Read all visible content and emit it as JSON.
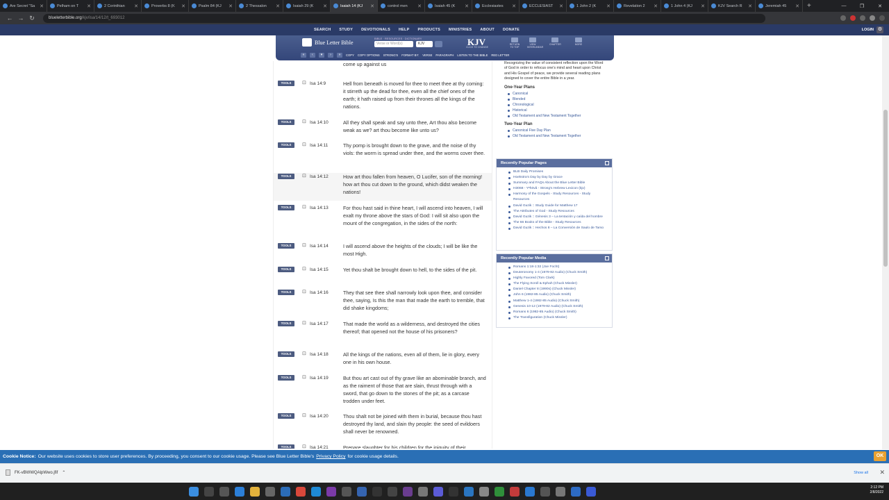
{
  "browser": {
    "tabs": [
      {
        "label": "Are Secret \"Sa"
      },
      {
        "label": "Pelham on T"
      },
      {
        "label": "2 Corinthian"
      },
      {
        "label": "Proverbs 8 (K"
      },
      {
        "label": "Psalm 84 (KJ"
      },
      {
        "label": "2 Thessalon"
      },
      {
        "label": "Isaiah 29 (K"
      },
      {
        "label": "Isaiah 14 (KJ"
      },
      {
        "label": "control men"
      },
      {
        "label": "Isaiah 45 (K"
      },
      {
        "label": "Ecclesiastes"
      },
      {
        "label": "ECCLESIAST"
      },
      {
        "label": "1 John 2 (K"
      },
      {
        "label": "Revelation 2"
      },
      {
        "label": "1 John 4 (KJ"
      },
      {
        "label": "KJV Search R"
      },
      {
        "label": "Jeremiah 45"
      }
    ],
    "url_domain": "blueletterbible.org",
    "url_path": "/kjv/isa/14/12/t_693012"
  },
  "sitenav": {
    "items": [
      "SEARCH",
      "STUDY",
      "DEVOTIONALS",
      "HELP",
      "PRODUCTS",
      "MINISTRIES",
      "ABOUT",
      "DONATE"
    ],
    "login": "LOGIN"
  },
  "bible_bar": {
    "logo": "Blue Letter Bible",
    "verse_label": "BIBLE · RESOURCES · DICTIONARY",
    "verse_placeholder": "Verse or Word(s)",
    "version": "KJV",
    "kjv_big": "KJV",
    "kjv_sub": "CLICK TO CHANGE",
    "icons": [
      "RETURN TO TOP",
      "VIEW INTERLINEAR",
      "CHAPTER",
      "MORE"
    ],
    "tools": [
      "COPY",
      "COPY OPTIONS",
      "STRONG'S",
      "FORMAT BY:",
      "VERSE",
      "PARAGRAPH",
      "LISTEN TO THE BIBLE",
      "RED LETTER"
    ]
  },
  "verses": [
    {
      "ref": "",
      "text": "come up against us"
    },
    {
      "ref": "Isa 14:9",
      "text": "Hell from beneath is moved for thee to meet thee at thy coming: it stirreth up the dead for thee, even all the chief ones of the earth; it hath raised up from their thrones all the kings of the nations."
    },
    {
      "ref": "Isa 14:10",
      "text": "All they shall speak and say unto thee, Art thou also become weak as we? art thou become like unto us?"
    },
    {
      "ref": "Isa 14:11",
      "text": "Thy pomp is brought down to the grave, and the noise of thy viols: the worm is spread under thee, and the worms cover thee."
    },
    {
      "ref": "Isa 14:12",
      "text": "How art thou fallen from heaven, O Lucifer, son of the morning! how art thou cut down to the ground, which didst weaken the nations!"
    },
    {
      "ref": "Isa 14:13",
      "text": "For thou hast said in thine heart, I will ascend into heaven, I will exalt my throne above the stars of God: I will sit also upon the mount of the congregation, in the sides of the north:"
    },
    {
      "ref": "Isa 14:14",
      "text": "I will ascend above the heights of the clouds; I will be like the most High."
    },
    {
      "ref": "Isa 14:15",
      "text": "Yet thou shalt be brought down to hell, to the sides of the pit."
    },
    {
      "ref": "Isa 14:16",
      "text": "They that see thee shall narrowly look upon thee, and consider thee, saying, Is this the man that made the earth to tremble, that did shake kingdoms;"
    },
    {
      "ref": "Isa 14:17",
      "text": "That made the world as a wilderness, and destroyed the cities thereof; that opened not the house of his prisoners?"
    },
    {
      "ref": "Isa 14:18",
      "text": "All the kings of the nations, even all of them, lie in glory, every one in his own house."
    },
    {
      "ref": "Isa 14:19",
      "text": "But thou art cast out of thy grave like an abominable branch, and as the raiment of those that are slain, thrust through with a sword, that go down to the stones of the pit; as a carcase trodden under feet."
    },
    {
      "ref": "Isa 14:20",
      "text": "Thou shalt not be joined with them in burial, because thou hast destroyed thy land, and slain thy people: the seed of evildoers shall never be renowned."
    },
    {
      "ref": "Isa 14:21",
      "text": "Prepare slaughter for his children for the iniquity of their"
    }
  ],
  "tools_label": "TOOLS",
  "sidebar": {
    "intro": "Recognizing the value of consistent reflection upon the Word of God in order to refocus one's mind and heart upon Christ and His Gospel of peace, we provide several reading plans designed to cover the entire Bible in a year.",
    "one_year_title": "One-Year Plans",
    "one_year": [
      "Canonical",
      "Blended",
      "Chronological",
      "Historical",
      "Old Testament and New Testament Together"
    ],
    "two_year_title": "Two-Year Plan",
    "two_year": [
      "Canonical Five Day Plan",
      "Old Testament and New Testament Together"
    ]
  },
  "popular_pages": {
    "title": "Recently Popular Pages",
    "items": [
      "BLB Daily Promises",
      "Hoekstra's Day by Day by Grace",
      "Summary and FAQs About the Blue Letter Bible",
      "H3068 - Yᵉhōvâ - Strong's Hebrew Lexicon (kjv)",
      "Harmony of the Gospels - Study Resources - Study Resources",
      "David Guzik :: Study Guide for Matthew 17",
      "The Attributes of God - Study Resources",
      "David Guzik :: Génesis 3 – La tentación y caída del hombre",
      "The 66 Books of the Bible - Study Resources",
      "David Guzik :: Hechos 8 – La Conversión de Saulo de Tarso"
    ]
  },
  "popular_media": {
    "title": "Recently Popular Media",
    "items": [
      "Romans 1:18-1:32 (Joe Focht)",
      "Deuteronomy 1-4 (1979-82 Audio) (Chuck Smith)",
      "Highly Favored (Tom Clark)",
      "The Flying Scroll & Ephah (Chuck Missler)",
      "Daniel Chapter 8 (1990s) (Chuck Missler)",
      "John 6 (1982-85 Audio) (Chuck Smith)",
      "Matthew 1-4 (1982-85 Audio) (Chuck Smith)",
      "Genesis 10-12 (1979-82 Audio) (Chuck Smith)",
      "Romans 6 (1982-85 Audio) (Chuck Smith)",
      "The Transfiguration (Chuck Missler)"
    ]
  },
  "cookie": {
    "label": "Cookie Notice:",
    "text": "Our website uses cookies to store user preferences. By proceeding, you consent to our cookie usage. Please see Blue Letter Bible's",
    "link": "Privacy Policy",
    "tail": "for cookie usage details.",
    "ok": "OK"
  },
  "download": {
    "file": "FK-vBWWQAlpWwo.jfif",
    "show_all": "Show all"
  },
  "tray": {
    "time": "2:12 PM",
    "date": "2/8/2022"
  },
  "colors": {
    "nav": "#2a3a66",
    "tools": "#4c5b80",
    "cookie": "#2a6fb5",
    "ok": "#e8a132",
    "link": "#3a5a9a"
  }
}
